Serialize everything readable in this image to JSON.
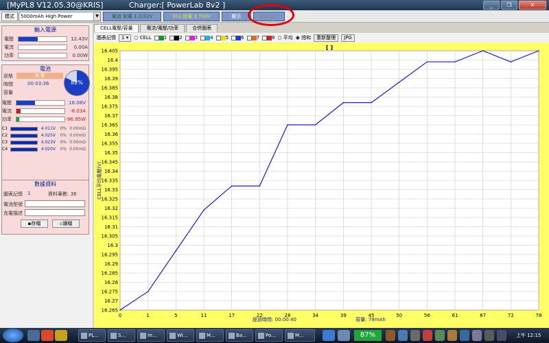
{
  "window": {
    "title": "[MyPL8 V12.05.30@KRIS]",
    "charger": "Charger:[ PowerLab 8v2 ]",
    "btn_minimize": "_",
    "btn_restore": "❐",
    "btn_close": "✕"
  },
  "toolbar": {
    "mode_label": "模式",
    "combo_value": "5000mAh  High Power",
    "stat1": "電池 充電 1.2/32V",
    "stat2": "30a 放電 3.700V",
    "stat3": "顯示",
    "stat4": "選項設定"
  },
  "input_power": {
    "title": "輸入電源",
    "rows": [
      {
        "label": "電壓",
        "value": "12.43V",
        "fill": 0.4
      },
      {
        "label": "電流",
        "value": "0.00A",
        "fill": 0
      },
      {
        "label": "功率",
        "value": "0.00W",
        "fill": 0
      }
    ]
  },
  "battery": {
    "title": "電池",
    "status_label": "狀態",
    "status_value": "放 電",
    "time_label": "時間",
    "time_value": "00:03:36",
    "capacity_label": "容量",
    "capacity_value": "",
    "percent": "82%",
    "rows": [
      {
        "label": "電壓",
        "value": "16.08V",
        "fill": 0.38,
        "color": "#1a3fc4"
      },
      {
        "label": "電流",
        "value": "-6.03A",
        "fill": 0.08,
        "color": "#d01818"
      },
      {
        "label": "功率",
        "value": "-96.95W",
        "fill": 0.05,
        "color": "#1aa31a"
      }
    ],
    "cells": [
      {
        "label": "C1",
        "voltage": "4.011V",
        "pct": "0%",
        "res": "0.00mΩ"
      },
      {
        "label": "C2",
        "voltage": "4.025V",
        "pct": "0%",
        "res": "0.00mΩ"
      },
      {
        "label": "C3",
        "voltage": "4.023V",
        "pct": "0%",
        "res": "0.00mΩ"
      },
      {
        "label": "C4",
        "voltage": "4.020V",
        "pct": "0%",
        "res": "0.00mΩ"
      }
    ]
  },
  "data_info": {
    "title": "數據資料",
    "chart_record_label": "圖表記憶",
    "chart_record_value": "1",
    "record_count": "資料筆數: 38",
    "battery_model_label": "電池型號",
    "charge_desc_label": "充電描述",
    "save_btn": "存檔",
    "load_btn": "讀檔"
  },
  "tabs": [
    {
      "label": "CELL電壓/容量"
    },
    {
      "label": "電流/電壓/功率"
    },
    {
      "label": "合併圖表"
    }
  ],
  "chart_controls": {
    "memory_label": "圖表記憶",
    "memory_value": "1",
    "cell_label": "CELL",
    "channels": [
      "1",
      "2",
      "3",
      "4",
      "5",
      "6",
      "7",
      "8"
    ],
    "avg_label": "平均",
    "sum_label": "總和",
    "refresh_btn": "重新整理",
    "jpg_btn": "JPG"
  },
  "chart_data": {
    "type": "line",
    "title": "[ ]",
    "xlabel": "經過時間: 00:00:40",
    "xlabel2": "容量: 78mAh",
    "ylabel": "CELL平均電壓(V)",
    "ylim": [
      16.265,
      16.405
    ],
    "x": [
      "0",
      "1",
      "5",
      "11",
      "17",
      "22",
      "28",
      "34",
      "39",
      "45",
      "50",
      "56",
      "61",
      "67",
      "72",
      "78"
    ],
    "yticks": [
      "16.405",
      "16.4",
      "16.395",
      "16.39",
      "16.385",
      "16.38",
      "16.375",
      "16.37",
      "16.365",
      "16.36",
      "16.355",
      "16.35",
      "16.345",
      "16.34",
      "16.335",
      "16.33",
      "16.325",
      "16.32",
      "16.315",
      "16.31",
      "16.305",
      "16.3",
      "16.295",
      "16.29",
      "16.285",
      "16.28",
      "16.275",
      "16.27",
      "16.265"
    ],
    "series": [
      {
        "values": [
          16.265,
          16.275,
          16.297,
          16.319,
          16.332,
          16.332,
          16.365,
          16.365,
          16.377,
          16.377,
          16.388,
          16.399,
          16.399,
          16.409,
          16.399,
          16.409
        ],
        "color": "#1a1ac0"
      }
    ],
    "grid": true
  },
  "taskbar": {
    "tasks": [
      "PL...",
      "S...",
      "m...",
      "Wi...",
      "M...",
      "Ba...",
      "Po...",
      "M..."
    ],
    "battery": "87%",
    "clock": "上午 12:15"
  }
}
